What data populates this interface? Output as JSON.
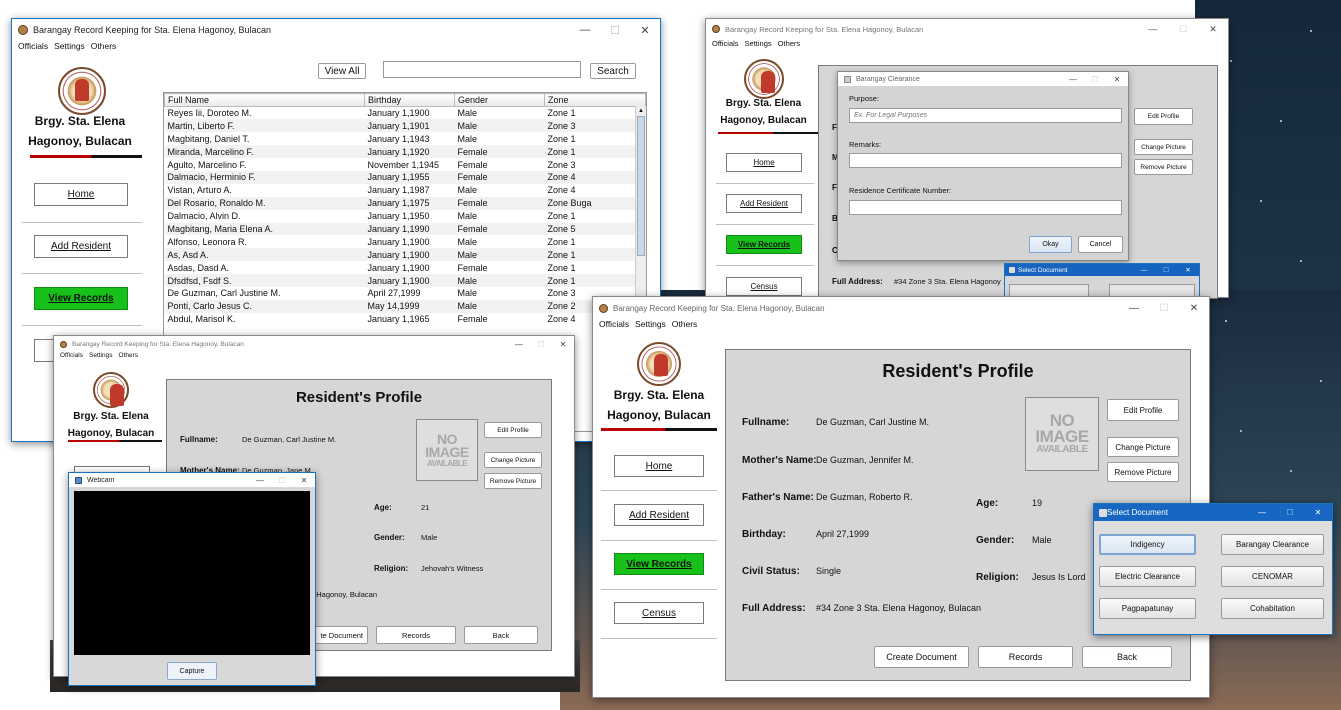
{
  "app_title": "Barangay Record Keeping for Sta. Elena Hagonoy, Bulacan",
  "menu": [
    "Officials",
    "Settings",
    "Others"
  ],
  "brand": {
    "line1": "Brgy. Sta. Elena",
    "line2": "Hagonoy, Bulacan"
  },
  "nav": {
    "home": "Home",
    "add": "Add Resident",
    "view": "View Records",
    "census": "Census"
  },
  "window_controls": {
    "min": "—",
    "max": "☐",
    "close": "✕"
  },
  "records": {
    "view_all": "View All",
    "search": "Search",
    "search_value": "",
    "columns": [
      "Full Name",
      "Birthday",
      "Gender",
      "Zone"
    ],
    "rows": [
      [
        "Reyes Iii, Doroteo M.",
        "January 1,1900",
        "Male",
        "Zone 1"
      ],
      [
        "Martin, Liberto F.",
        "January 1,1901",
        "Male",
        "Zone 3"
      ],
      [
        "Magbitang, Daniel T.",
        "January 1,1943",
        "Male",
        "Zone 1"
      ],
      [
        "Miranda, Marcelino F.",
        "January 1,1920",
        "Female",
        "Zone 1"
      ],
      [
        "Agulto, Marcelino F.",
        "November 1,1945",
        "Female",
        "Zone 3"
      ],
      [
        "Dalmacio, Herminio F.",
        "January 1,1955",
        "Female",
        "Zone 4"
      ],
      [
        "Vistan, Arturo A.",
        "January 1,1987",
        "Male",
        "Zone 4"
      ],
      [
        "Del Rosario, Ronaldo M.",
        "January 1,1975",
        "Female",
        "Zone Buga"
      ],
      [
        "Dalmacio, Alvin D.",
        "January 1,1950",
        "Male",
        "Zone 1"
      ],
      [
        "Magbitang, Maria Elena A.",
        "January 1,1990",
        "Female",
        "Zone 5"
      ],
      [
        "Alfonso, Leonora R.",
        "January 1,1900",
        "Male",
        "Zone 1"
      ],
      [
        "As, Asd A.",
        "January 1,1900",
        "Male",
        "Zone 1"
      ],
      [
        "Asdas, Dasd A.",
        "January 1,1900",
        "Female",
        "Zone 1"
      ],
      [
        "Dfsdfsd, Fsdf S.",
        "January 1,1900",
        "Male",
        "Zone 1"
      ],
      [
        "De Guzman, Carl Justine M.",
        "April 27,1999",
        "Male",
        "Zone 3"
      ],
      [
        "Ponti, Carlo Jesus C.",
        "May 14,1999",
        "Male",
        "Zone 2"
      ],
      [
        "Abdul, Marisol K.",
        "January 1,1965",
        "Female",
        "Zone 4"
      ]
    ]
  },
  "clearance": {
    "title": "Barangay Clearance",
    "purpose_label": "Purpose:",
    "purpose_placeholder": "Ex. For Legal Purposes",
    "remarks_label": "Remarks:",
    "cert_label": "Residence Certificate Number:",
    "okay": "Okay",
    "cancel": "Cancel",
    "full_address_label": "Full Address:",
    "full_address_value": "#34 Zone 3 Sta. Elena Hagonoy"
  },
  "webcam": {
    "title": "Webcam",
    "capture": "Capture"
  },
  "profile": {
    "title": "Resident's Profile",
    "no_image": [
      "NO",
      "IMAGE",
      "AVAILABLE"
    ],
    "edit": "Edit Profile",
    "change": "Change Picture",
    "remove": "Remove Picture",
    "labels": {
      "fullname": "Fullname:",
      "mother": "Mother's Name:",
      "father": "Father's Name:",
      "birthday": "Birthday:",
      "civil": "Civil Status:",
      "address": "Full Address:",
      "age": "Age:",
      "gender": "Gender:",
      "religion": "Religion:"
    },
    "values": {
      "fullname": "De Guzman, Carl Justine M.",
      "mother": "De Guzman, Jennifer M.",
      "father": "De Guzman, Roberto R.",
      "birthday": "April 27,1999",
      "civil": "Single",
      "address": "#34 Zone 3 Sta. Elena Hagonoy, Bulacan",
      "age": "19",
      "gender": "Male",
      "religion": "Jesus Is Lord"
    },
    "left_values": {
      "mother_partial": "De Guzman, Jane M",
      "age": "21",
      "gender": "Male",
      "religion": "Jehovah's Witness",
      "address_partial": "a Hagonoy, Bulacan",
      "create_partial": "te Document"
    },
    "create": "Create Document",
    "records": "Records",
    "back": "Back"
  },
  "select_doc": {
    "title": "Select Document",
    "buttons": [
      "Indigency",
      "Barangay Clearance",
      "Electric Clearance",
      "CENOMAR",
      "Pagpapatunay",
      "Cohabitation"
    ]
  }
}
